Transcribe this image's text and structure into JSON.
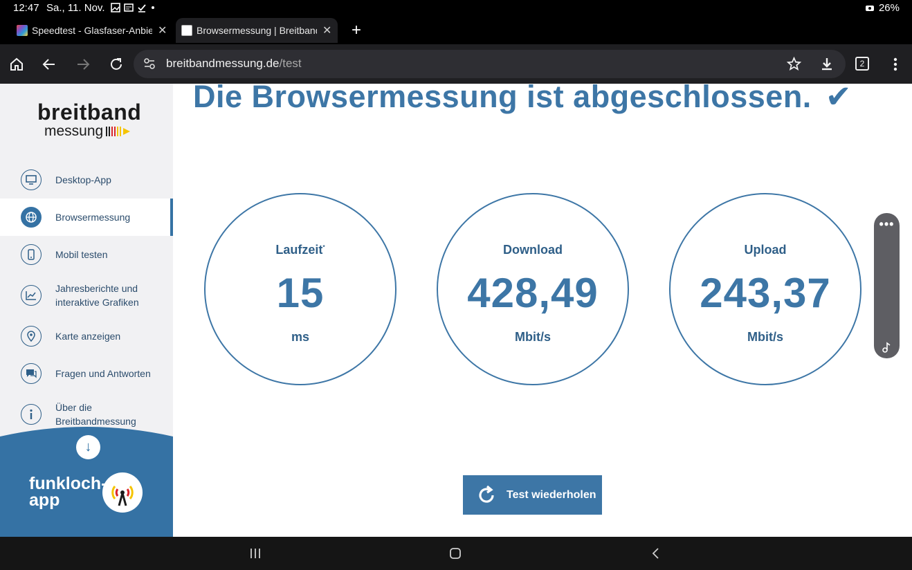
{
  "status_bar": {
    "time": "12:47",
    "date": "Sa., 11. Nov.",
    "battery": "26%"
  },
  "tabs": [
    {
      "title": "Speedtest - Glasfaser-Anbieter"
    },
    {
      "title": "Browsermessung | Breitbandmessung"
    }
  ],
  "address_bar": {
    "domain": "breitbandmessung.de",
    "path": "/test",
    "tab_count": "2"
  },
  "sidebar": {
    "logo_line1": "breitband",
    "logo_line2": "messung",
    "items": [
      {
        "label": "Desktop-App",
        "icon": "monitor-icon"
      },
      {
        "label": "Browsermessung",
        "icon": "globe-icon",
        "active": true
      },
      {
        "label": "Mobil testen",
        "icon": "phone-icon"
      },
      {
        "label": "Jahresberichte und interaktive Grafiken",
        "icon": "chart-icon"
      },
      {
        "label": "Karte anzeigen",
        "icon": "map-pin-icon"
      },
      {
        "label": "Fragen und Antworten",
        "icon": "chat-icon"
      },
      {
        "label": "Über die Breitbandmessung",
        "icon": "info-icon"
      }
    ],
    "funkloch_line1": "funkloch-",
    "funkloch_line2": "app"
  },
  "main": {
    "headline": "Die Browsermessung ist abgeschlossen.",
    "results": [
      {
        "label": "Laufzeit",
        "marker": "*",
        "value": "15",
        "unit": "ms"
      },
      {
        "label": "Download",
        "marker": "",
        "value": "428,49",
        "unit": "Mbit/s"
      },
      {
        "label": "Upload",
        "marker": "",
        "value": "243,37",
        "unit": "Mbit/s"
      }
    ],
    "repeat_button": "Test wiederholen"
  },
  "colors": {
    "accent": "#3d76a6",
    "sidebar_bg": "#f1f1f3",
    "funkloch_bg": "#3572a4"
  }
}
